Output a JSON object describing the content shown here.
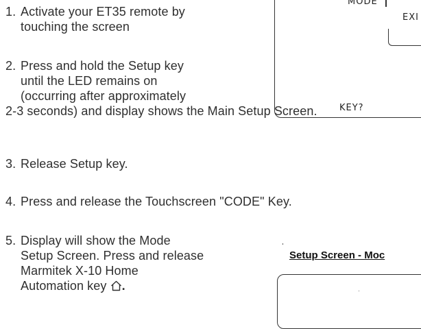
{
  "steps": [
    {
      "number": "1.",
      "lines": [
        "Activate your ET35 remote by",
        "touching the screen"
      ]
    },
    {
      "number": "2.",
      "lines": [
        "Press and hold the Setup key",
        "until the LED remains on",
        "(occurring after approximately",
        "2-3 seconds) and display shows the Main Setup Screen."
      ]
    },
    {
      "number": "3.",
      "lines": [
        "Release Setup key."
      ]
    },
    {
      "number": "4.",
      "lines": [
        "Press and release the Touchscreen \"CODE\" Key."
      ]
    },
    {
      "number": "5.",
      "lines": [
        "Display will show the Mode",
        "Setup Screen. Press and release",
        "Marmitek X-10 Home",
        "Automation key"
      ],
      "trailing_icon": "house-icon",
      "trailing_text": "."
    }
  ],
  "main_setup_screen": {
    "mode_label": "MODE",
    "exit_label": "EXI",
    "key_label": "KEY?"
  },
  "mode_setup_screen": {
    "title": "Setup Screen - Moc"
  }
}
